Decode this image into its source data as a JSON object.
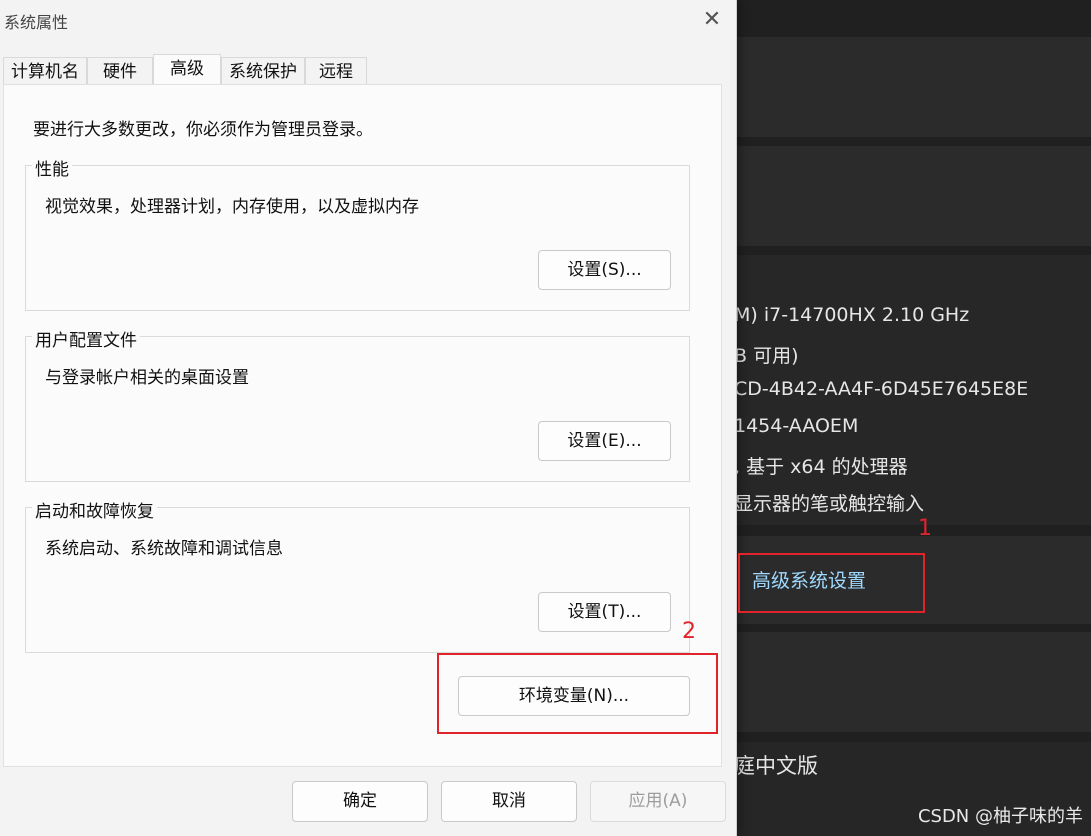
{
  "background": {
    "specs": [
      "M) i7-14700HX   2.10 GHz",
      "B 可用)",
      "CD-4B42-AA4F-6D45E7645E8E",
      "1454-AAOEM",
      ", 基于 x64 的处理器",
      "显示器的笔或触控输入"
    ],
    "advanced_link": "高级系统设置",
    "edition": "庭中文版",
    "annotation_1": "1",
    "annotation_2": "2",
    "watermark": "CSDN @柚子味的羊",
    "annotation_color": "#e0242c"
  },
  "dialog": {
    "title": "系统属性",
    "close_icon": "close-icon",
    "tabs": [
      "计算机名",
      "硬件",
      "高级",
      "系统保护",
      "远程"
    ],
    "active_tab": "高级",
    "admin_note": "要进行大多数更改，你必须作为管理员登录。",
    "groups": [
      {
        "title": "性能",
        "description": "视觉效果，处理器计划，内存使用，以及虚拟内存",
        "button": "设置(S)..."
      },
      {
        "title": "用户配置文件",
        "description": "与登录帐户相关的桌面设置",
        "button": "设置(E)..."
      },
      {
        "title": "启动和故障恢复",
        "description": "系统启动、系统故障和调试信息",
        "button": "设置(T)..."
      }
    ],
    "env_button": "环境变量(N)...",
    "footer": {
      "ok": "确定",
      "cancel": "取消",
      "apply": "应用(A)"
    }
  }
}
